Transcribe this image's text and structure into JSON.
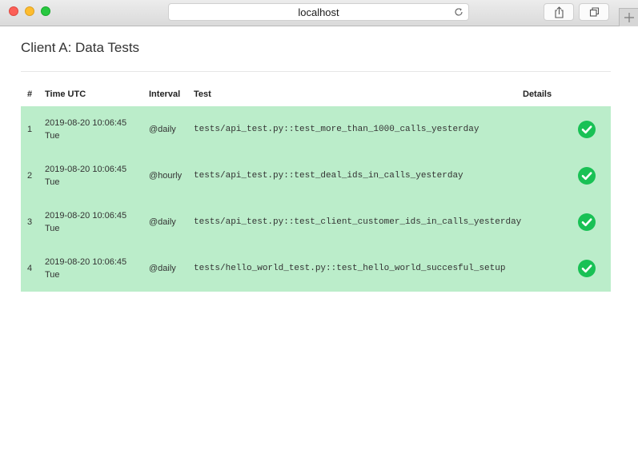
{
  "browser": {
    "url": "localhost",
    "icons": {
      "reload": "reload-icon",
      "share": "share-icon",
      "tabs": "tabs-icon",
      "new_tab": "plus-icon"
    }
  },
  "page": {
    "title": "Client A: Data Tests"
  },
  "table": {
    "headers": {
      "num": "#",
      "time": "Time UTC",
      "interval": "Interval",
      "test": "Test",
      "details": "Details"
    },
    "row_color": "#bbedca",
    "status_color": "#19c155",
    "rows": [
      {
        "num": "1",
        "date": "2019-08-20 10:06:45",
        "day": "Tue",
        "interval": "@daily",
        "test": "tests/api_test.py::test_more_than_1000_calls_yesterday",
        "status": "passed-check-icon"
      },
      {
        "num": "2",
        "date": "2019-08-20 10:06:45",
        "day": "Tue",
        "interval": "@hourly",
        "test": "tests/api_test.py::test_deal_ids_in_calls_yesterday",
        "status": "passed-check-icon"
      },
      {
        "num": "3",
        "date": "2019-08-20 10:06:45",
        "day": "Tue",
        "interval": "@daily",
        "test": "tests/api_test.py::test_client_customer_ids_in_calls_yesterday",
        "status": "passed-check-icon"
      },
      {
        "num": "4",
        "date": "2019-08-20 10:06:45",
        "day": "Tue",
        "interval": "@daily",
        "test": "tests/hello_world_test.py::test_hello_world_succesful_setup",
        "status": "passed-check-icon"
      }
    ]
  }
}
